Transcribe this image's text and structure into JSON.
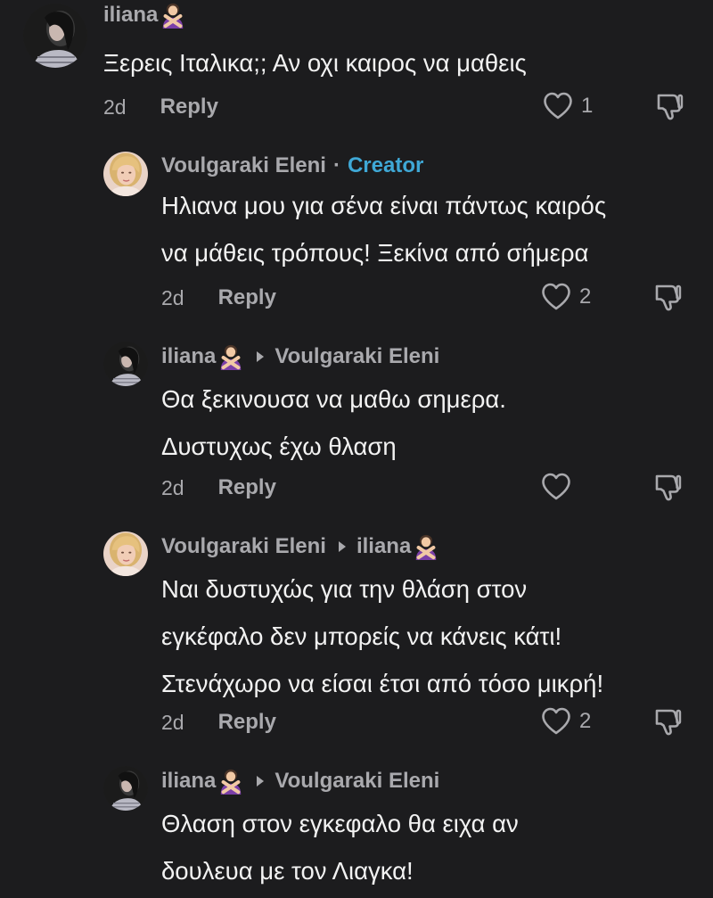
{
  "comments": [
    {
      "username": "iliana",
      "text_lines": [
        "Ξερεις Ιταλικα;; Αν οχι καιρος να μαθεις"
      ],
      "time": "2d",
      "reply_label": "Reply",
      "like_count": "1"
    },
    {
      "username": "Voulgaraki Eleni",
      "separator": "·",
      "badge": "Creator",
      "text_lines": [
        "Ηλιανα μου για σένα είναι πάντως καιρός",
        "να μάθεις τρόπους! Ξεκίνα από σήμερα"
      ],
      "time": "2d",
      "reply_label": "Reply",
      "like_count": "2"
    },
    {
      "username": "iliana",
      "reply_to": "Voulgaraki Eleni",
      "text_lines": [
        "Θα ξεκινουσα να μαθω σημερα.",
        "Δυστυχως έχω θλαση"
      ],
      "time": "2d",
      "reply_label": "Reply",
      "like_count": ""
    },
    {
      "username": "Voulgaraki Eleni",
      "reply_to": "iliana",
      "text_lines": [
        "Ναι δυστυχώς για την θλάση στον",
        "εγκέφαλο δεν μπορείς να κάνεις κάτι!",
        "Στενάχωρο να είσαι έτσι από τόσο μικρή!"
      ],
      "time": "2d",
      "reply_label": "Reply",
      "like_count": "2"
    },
    {
      "username": "iliana",
      "reply_to": "Voulgaraki Eleni",
      "text_lines": [
        "Θλαση στον εγκεφαλο θα ειχα αν",
        "δουλευα με τον Λιαγκα!"
      ]
    }
  ],
  "icons": {
    "like": "heart-outline-icon",
    "dislike": "thumbs-down-outline-icon",
    "reply_arrow": "triangle-right-icon",
    "emoji": "person-gesturing-no-emoji"
  },
  "colors": {
    "background": "#1c1c1e",
    "text": "#f2f2f2",
    "muted": "#a9a9ad",
    "creator_badge": "#3fa8d6",
    "emoji_purple": "#7b3fa8"
  }
}
